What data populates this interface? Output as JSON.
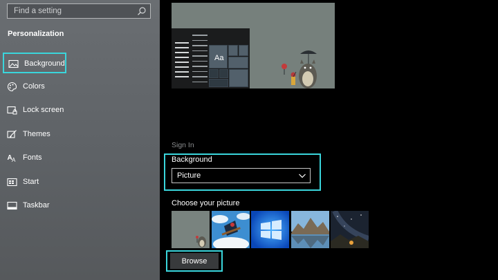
{
  "search": {
    "placeholder": "Find a setting",
    "icon": "search-icon"
  },
  "sidebar": {
    "title": "Personalization",
    "items": [
      {
        "label": "Background",
        "icon": "picture-icon",
        "selected": true
      },
      {
        "label": "Colors",
        "icon": "palette-icon",
        "selected": false
      },
      {
        "label": "Lock screen",
        "icon": "lock-screen-icon",
        "selected": false
      },
      {
        "label": "Themes",
        "icon": "brush-icon",
        "selected": false
      },
      {
        "label": "Fonts",
        "icon": "font-icon",
        "selected": false
      },
      {
        "label": "Start",
        "icon": "start-icon",
        "selected": false
      },
      {
        "label": "Taskbar",
        "icon": "taskbar-icon",
        "selected": false
      }
    ]
  },
  "preview": {
    "tile_label": "Aa"
  },
  "main": {
    "section_label": "Sign In",
    "background_label": "Background",
    "background_value": "Picture",
    "choose_label": "Choose your picture",
    "browse_label": "Browse"
  },
  "colors": {
    "highlight": "#3ad6dc",
    "sidebar_bg": "#63676b",
    "main_bg": "#000000"
  }
}
